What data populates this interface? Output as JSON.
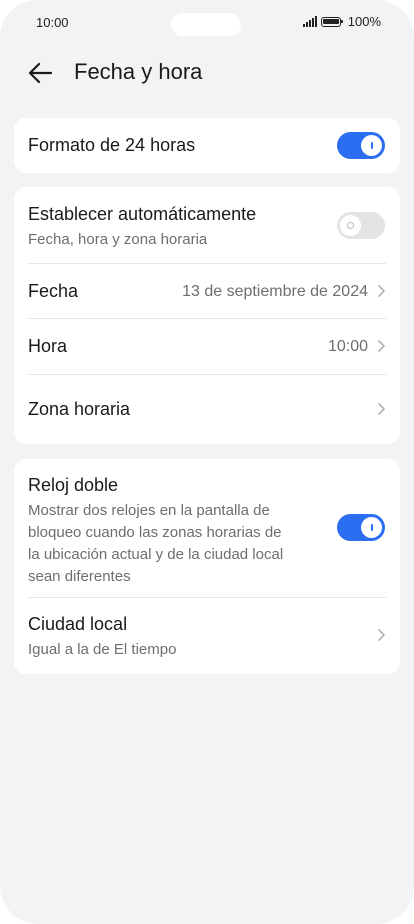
{
  "status_bar": {
    "time": "10:00",
    "battery": "100%",
    "icons": [
      "signal-icon",
      "battery-icon"
    ]
  },
  "header": {
    "back_icon": "arrow-left-icon",
    "title": "Fecha y hora"
  },
  "section1": {
    "format24": {
      "label": "Formato de 24 horas",
      "enabled": true
    }
  },
  "section2": {
    "auto": {
      "label": "Establecer automáticamente",
      "sublabel": "Fecha, hora y zona horaria",
      "enabled": false
    },
    "date": {
      "label": "Fecha",
      "value": "13 de septiembre de 2024"
    },
    "time": {
      "label": "Hora",
      "value": "10:00"
    },
    "timezone": {
      "label": "Zona horaria"
    }
  },
  "section3": {
    "dual_clock": {
      "label": "Reloj doble",
      "description_lines": [
        "Mostrar dos relojes en la pantalla de",
        "bloqueo cuando las zonas horarias de",
        "la ubicación actual y de la ciudad local",
        "sean diferentes"
      ],
      "enabled": true
    },
    "home_city": {
      "label": "Ciudad local",
      "sublabel": "Igual a la de El tiempo"
    }
  },
  "colors": {
    "accent": "#2b6ef2",
    "background": "#f1f3f5",
    "card": "#ffffff",
    "secondary_text": "#6e6e6e"
  }
}
